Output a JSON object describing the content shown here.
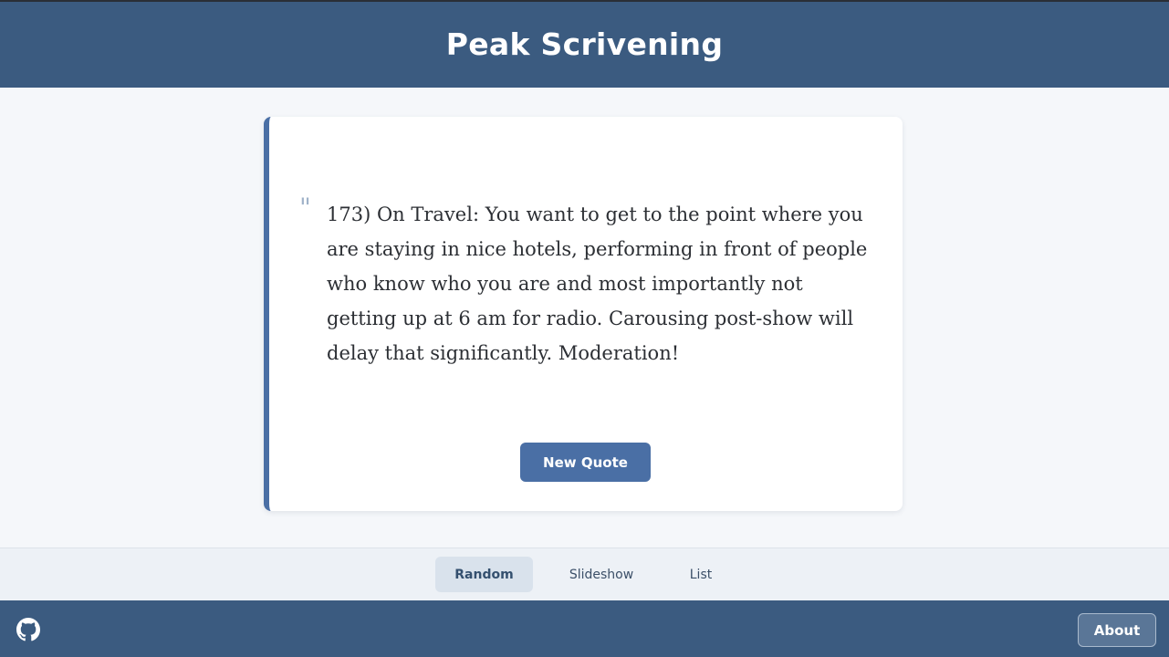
{
  "app": {
    "title": "Peak Scrivening"
  },
  "quote": {
    "mark": "\"",
    "text": "173) On Travel: You want to get to the point where you are staying in nice hotels, performing in front of people who know who you are and most importantly not getting up at 6 am for radio. Carousing post-show will delay that significantly. Moderation!"
  },
  "actions": {
    "new_quote_label": "New Quote"
  },
  "tabs": {
    "items": [
      {
        "label": "Random",
        "active": true
      },
      {
        "label": "Slideshow",
        "active": false
      },
      {
        "label": "List",
        "active": false
      }
    ]
  },
  "footer": {
    "github_icon": "github-icon",
    "about_label": "About"
  },
  "colors": {
    "header_bg": "#3b5b80",
    "accent": "#4a6fa5",
    "page_bg": "#f5f7fa",
    "tabbar_bg": "#edf1f6"
  }
}
